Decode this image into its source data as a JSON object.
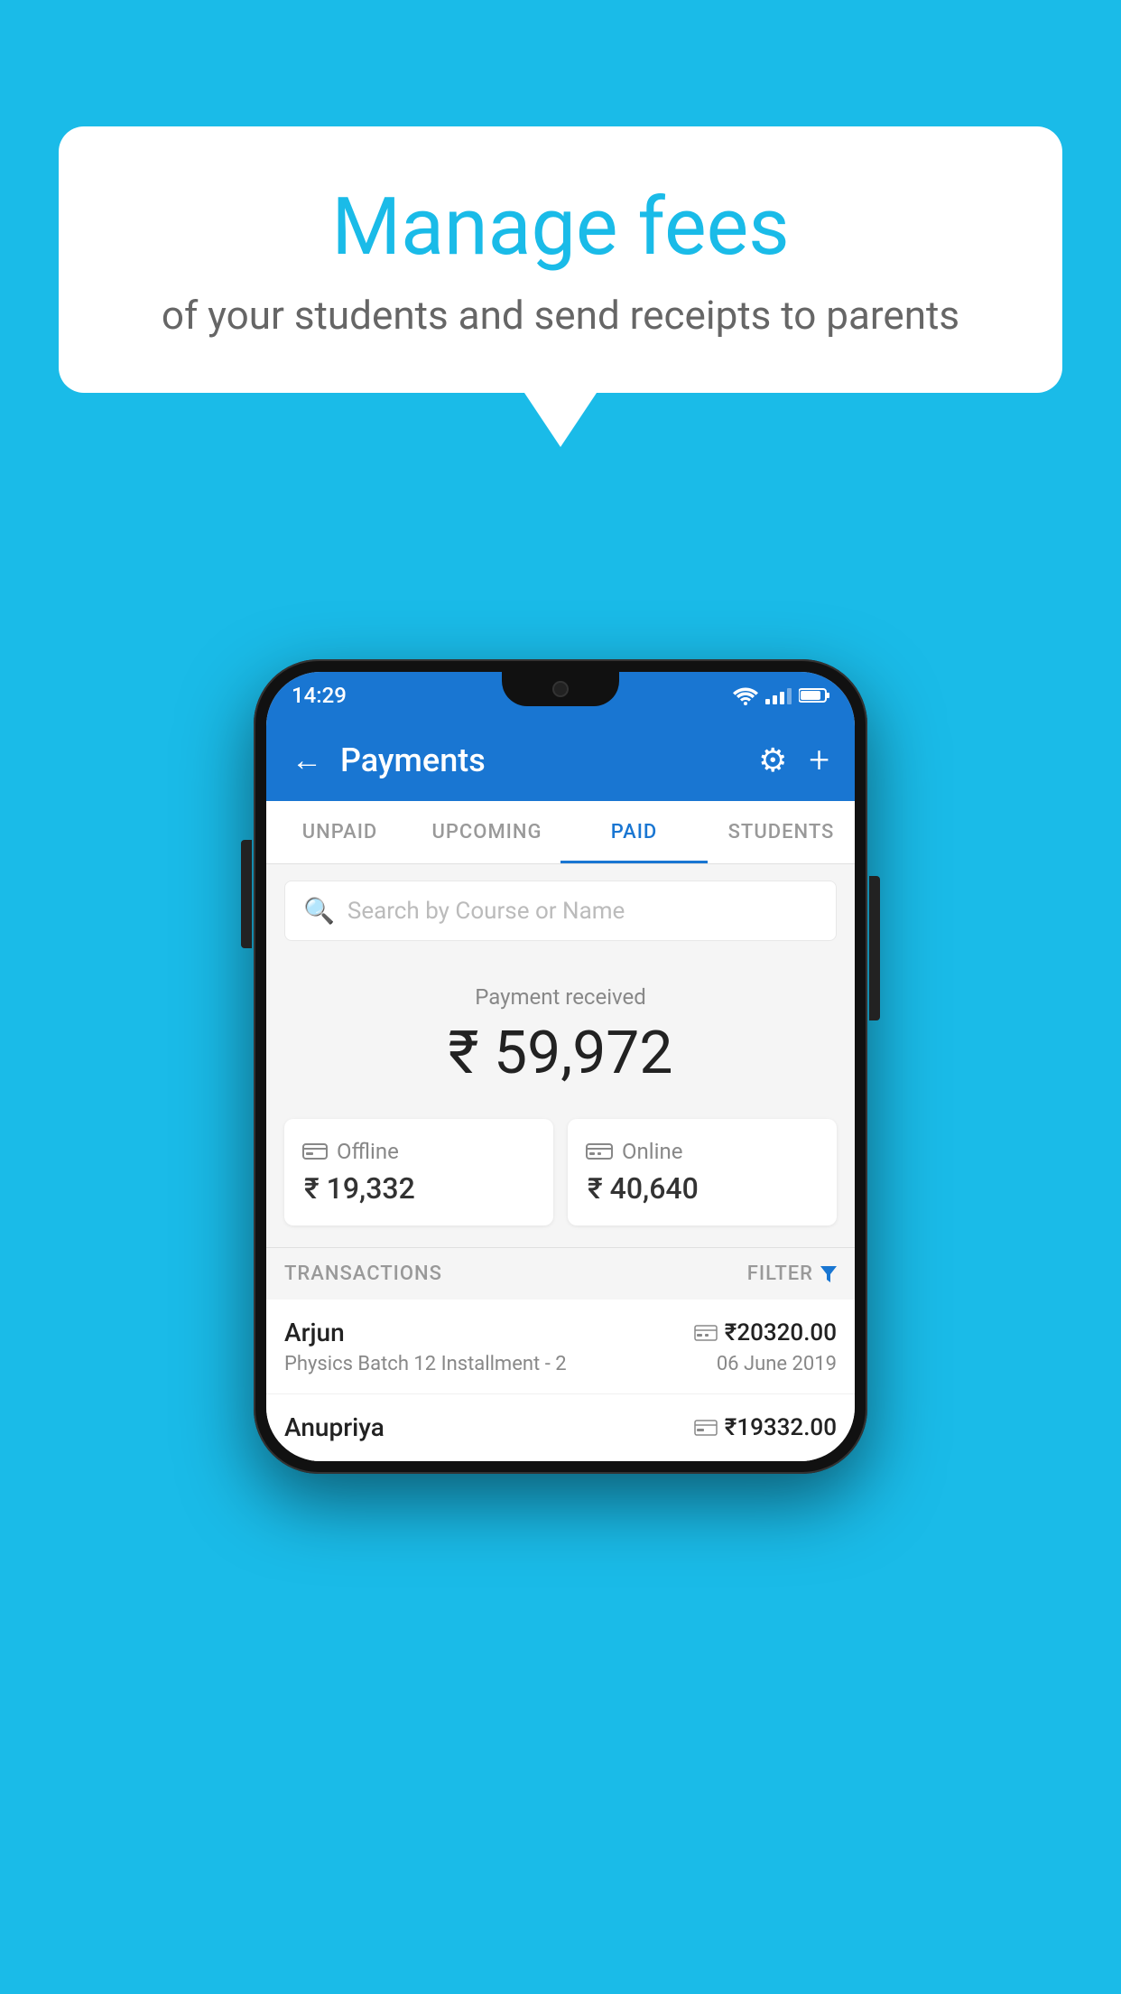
{
  "background_color": "#1ABBE8",
  "speech_bubble": {
    "title": "Manage fees",
    "subtitle": "of your students and send receipts to parents"
  },
  "status_bar": {
    "time": "14:29",
    "wifi": "▾",
    "signal": "▾",
    "battery": "▮"
  },
  "app_header": {
    "title": "Payments",
    "back_label": "←",
    "gear_label": "⚙",
    "plus_label": "+"
  },
  "tabs": [
    {
      "label": "UNPAID",
      "active": false
    },
    {
      "label": "UPCOMING",
      "active": false
    },
    {
      "label": "PAID",
      "active": true
    },
    {
      "label": "STUDENTS",
      "active": false
    }
  ],
  "search": {
    "placeholder": "Search by Course or Name"
  },
  "payment_summary": {
    "label": "Payment received",
    "amount": "₹ 59,972",
    "offline": {
      "label": "Offline",
      "amount": "₹ 19,332"
    },
    "online": {
      "label": "Online",
      "amount": "₹ 40,640"
    }
  },
  "transactions": {
    "header_label": "TRANSACTIONS",
    "filter_label": "FILTER",
    "rows": [
      {
        "name": "Arjun",
        "detail": "Physics Batch 12 Installment - 2",
        "amount": "₹20320.00",
        "date": "06 June 2019",
        "type": "online"
      },
      {
        "name": "Anupriya",
        "detail": "",
        "amount": "₹19332.00",
        "date": "",
        "type": "offline"
      }
    ]
  }
}
